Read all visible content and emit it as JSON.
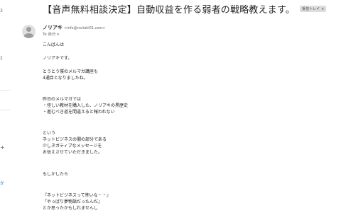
{
  "left_strip": {
    "items": [
      "3",
      "2",
      "+",
      "か"
    ]
  },
  "subject": {
    "text": "【音声無料相談決定】自動収益を作る弱者の戦略教えます。",
    "badge_label": "受信トレイ",
    "badge_close": "×"
  },
  "sender": {
    "name": "ノリアキ",
    "email": "<info@noriaki01.com>",
    "to_label": "To 自分",
    "to_chevron": "▾"
  },
  "body_lines": [
    "こんばんは",
    "ノリアキです。",
    "とうとう僕のメルマガ講座も",
    "4通目となりましたね。",
    "昨日のメルマガでは",
    "・怪しい教材を購入した、ノリアキの黒歴史",
    "・進むべき道を間違えると報われない",
    "という",
    "ネットビジネスの闇の部分である",
    "少しネガティブなメッセージを",
    "お伝えさせていただきました。",
    "もしかしたら",
    "『ネットビジネスって怖いな・・』",
    "『やっぱり夢物語だったんだ』",
    "とか思ったかもしれませんし"
  ]
}
